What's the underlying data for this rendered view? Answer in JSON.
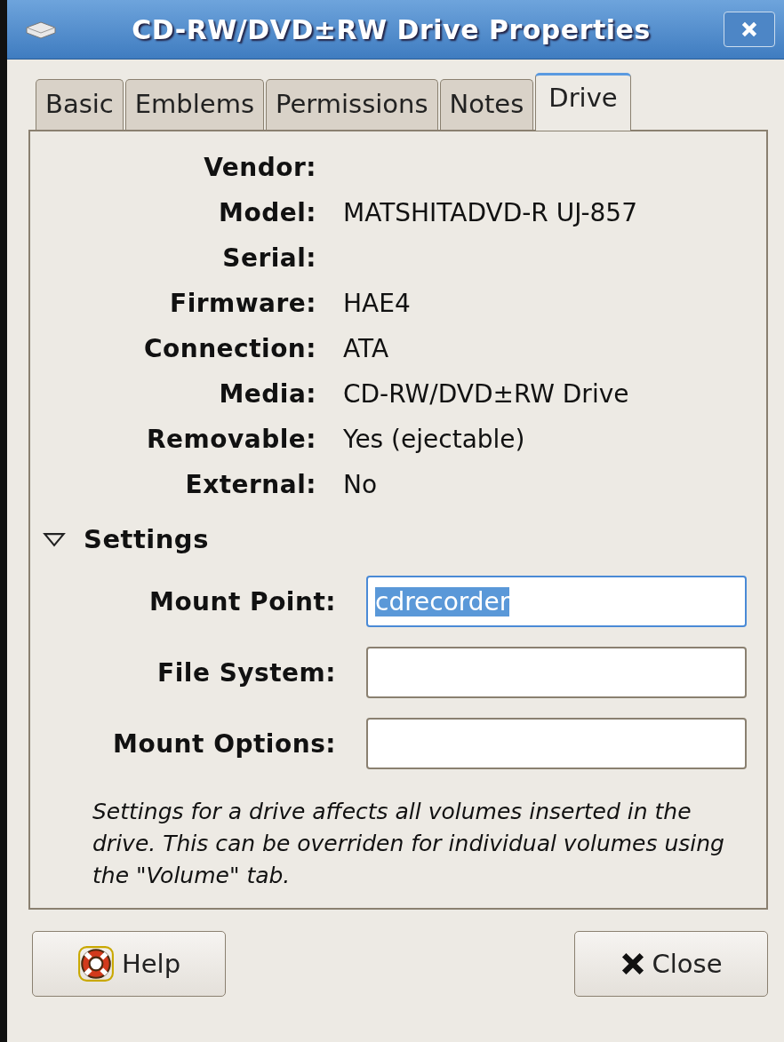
{
  "window": {
    "title": "CD-RW/DVD±RW Drive Properties"
  },
  "tabs": [
    {
      "label": "Basic",
      "selected": false
    },
    {
      "label": "Emblems",
      "selected": false
    },
    {
      "label": "Permissions",
      "selected": false
    },
    {
      "label": "Notes",
      "selected": false
    },
    {
      "label": "Drive",
      "selected": true
    }
  ],
  "properties": [
    {
      "label": "Vendor:"
    },
    {
      "label": "Model:",
      "value": "MATSHITADVD-R UJ-857"
    },
    {
      "label": "Serial:"
    },
    {
      "label": "Firmware:",
      "value": "HAE4"
    },
    {
      "label": "Connection:",
      "value": "ATA"
    },
    {
      "label": "Media:",
      "value": "CD-RW/DVD±RW Drive"
    },
    {
      "label": "Removable:",
      "value": "Yes (ejectable)"
    },
    {
      "label": "External:",
      "value": "No"
    }
  ],
  "settings": {
    "title": "Settings",
    "expanded": true,
    "fields": [
      {
        "label": "Mount Point:",
        "value": "cdrecorder",
        "selected": true
      },
      {
        "label": "File System:"
      },
      {
        "label": "Mount Options:"
      }
    ],
    "note": "Settings for a drive affects all volumes inserted in the drive. This can be overriden for individual volumes using the \"Volume\" tab."
  },
  "buttons": [
    {
      "kind": "help",
      "label": "Help"
    },
    {
      "kind": "close",
      "label": "Close"
    }
  ]
}
